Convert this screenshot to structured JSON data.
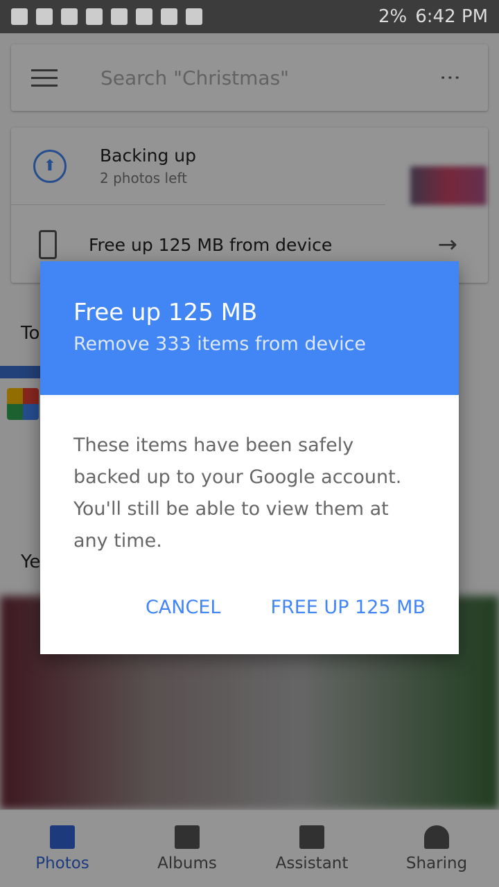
{
  "status_bar": {
    "battery": "2%",
    "time": "6:42 PM",
    "icons": [
      "messages-icon",
      "youtube-icon",
      "alert-icon",
      "facebook-icon",
      "gallery-icon",
      "phone-check-icon",
      "email-icon",
      "email-icon",
      "app-icon",
      "alarm-icon",
      "wifi-icon",
      "sim2-icon",
      "signal-icon",
      "signal-icon",
      "battery-low-icon"
    ]
  },
  "search": {
    "placeholder": "Search \"Christmas\""
  },
  "backup": {
    "title": "Backing up",
    "subtitle": "2 photos left",
    "free_up": "Free up 125 MB from device"
  },
  "sections": {
    "today": "To",
    "yesterday": "Ye"
  },
  "dialog": {
    "title": "Free up 125 MB",
    "subtitle": "Remove 333 items from device",
    "body": "These items have been safely backed up to your Google account. You'll still be able to view them at any time.",
    "cancel": "CANCEL",
    "confirm": "FREE UP 125 MB",
    "header_color": "#4285f4"
  },
  "nav": [
    {
      "label": "Photos",
      "active": true
    },
    {
      "label": "Albums"
    },
    {
      "label": "Assistant"
    },
    {
      "label": "Sharing"
    }
  ]
}
